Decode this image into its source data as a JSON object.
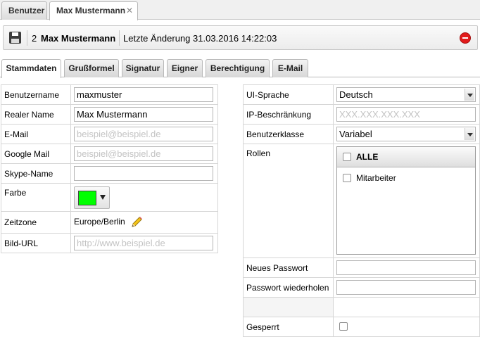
{
  "doc_tabs": [
    {
      "label": "Benutzer"
    },
    {
      "label": "Max Mustermann",
      "close": "✕"
    }
  ],
  "header": {
    "id": "2",
    "name": "Max Mustermann",
    "last_change": "Letzte Änderung 31.03.2016 14:22:03"
  },
  "tabs": [
    "Stammdaten",
    "Grußformel",
    "Signatur",
    "Eigner",
    "Berechtigung",
    "E-Mail"
  ],
  "left_form": {
    "username": {
      "label": "Benutzername",
      "value": "maxmuster"
    },
    "realname": {
      "label": "Realer Name",
      "value": "Max Mustermann"
    },
    "email": {
      "label": "E-Mail",
      "value": "",
      "placeholder": "beispiel@beispiel.de"
    },
    "google_mail": {
      "label": "Google Mail",
      "value": "",
      "placeholder": "beispiel@beispiel.de"
    },
    "skype": {
      "label": "Skype-Name",
      "value": ""
    },
    "color": {
      "label": "Farbe",
      "value": "#00ff00"
    },
    "timezone": {
      "label": "Zeitzone",
      "value": "Europe/Berlin"
    },
    "image_url": {
      "label": "Bild-URL",
      "value": "",
      "placeholder": "http://www.beispiel.de"
    }
  },
  "right_form": {
    "ui_language": {
      "label": "UI-Sprache",
      "value": "Deutsch"
    },
    "ip_restriction": {
      "label": "IP-Beschränkung",
      "value": "",
      "placeholder": "XXX.XXX.XXX.XXX"
    },
    "user_class": {
      "label": "Benutzerklasse",
      "value": "Variabel"
    },
    "roles": {
      "label": "Rollen",
      "all_label": "ALLE",
      "items": [
        "Mitarbeiter"
      ]
    },
    "new_password": {
      "label": "Neues Passwort"
    },
    "repeat_password": {
      "label": "Passwort wiederholen"
    },
    "locked": {
      "label": "Gesperrt"
    }
  },
  "icons": {
    "save": "save-icon",
    "stop": "stop-icon",
    "pencil": "pencil-icon",
    "close": "close-icon"
  },
  "colors": {
    "color_swatch": "#00ff00",
    "stop_red": "#e21b1b"
  }
}
